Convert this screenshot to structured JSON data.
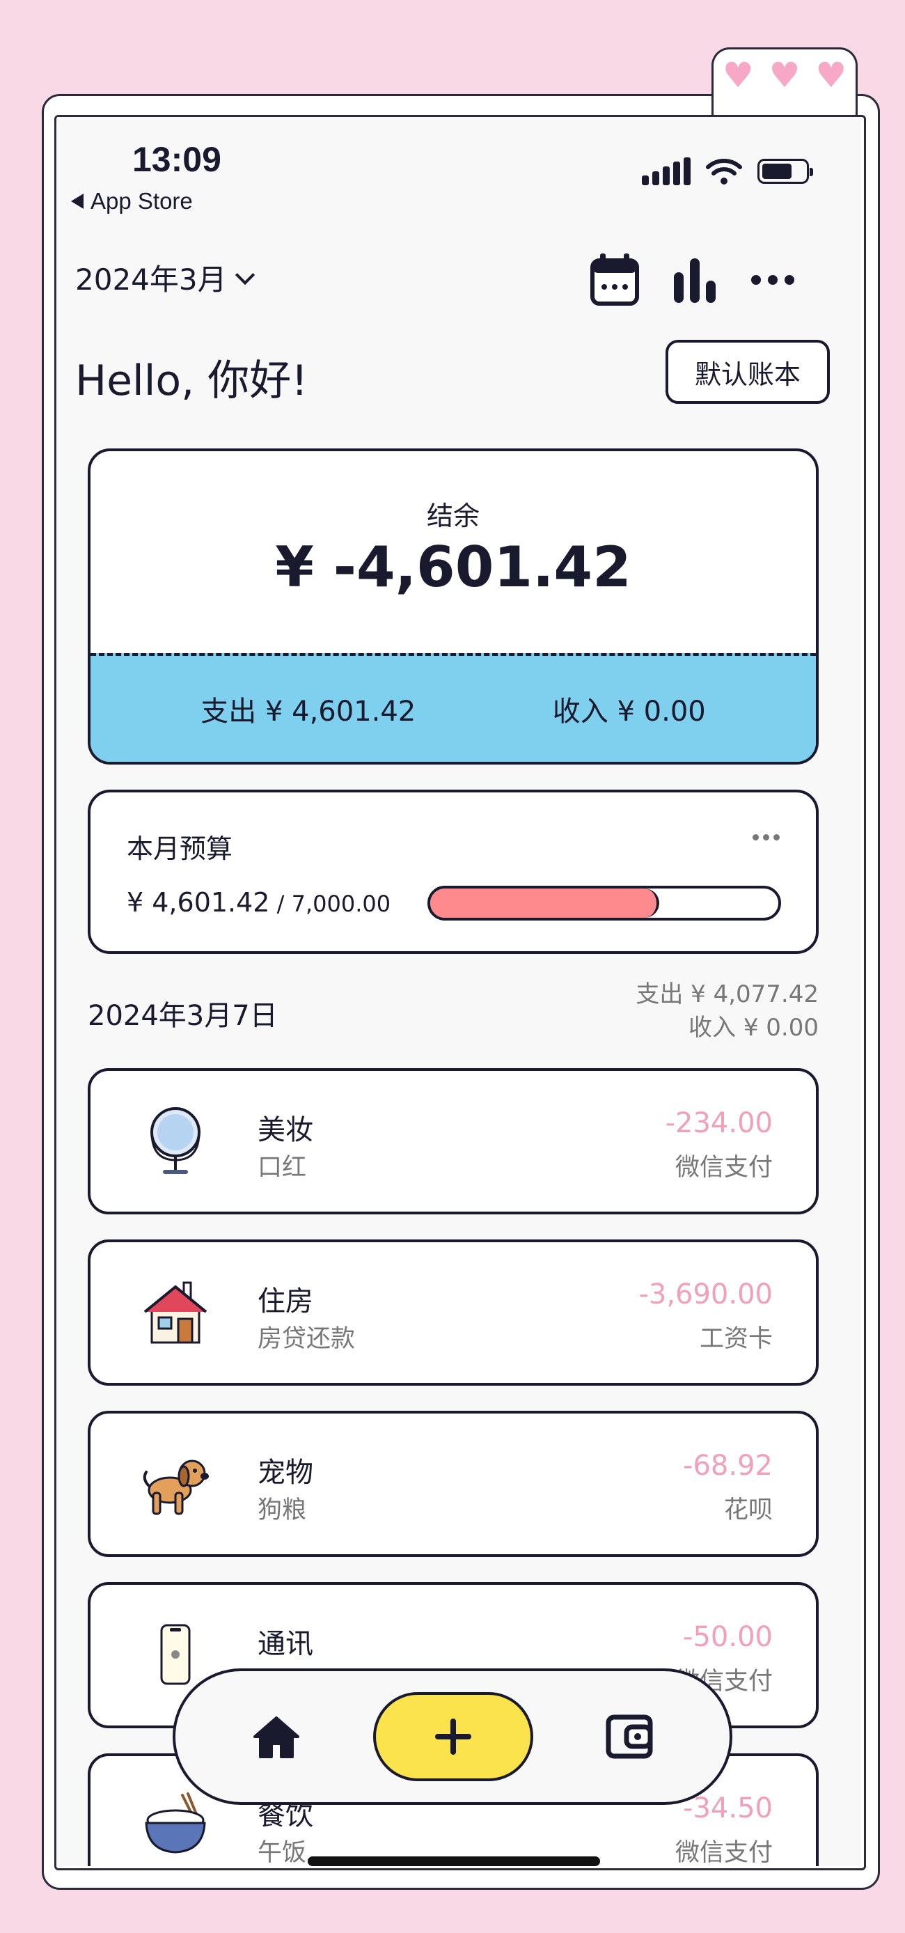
{
  "status_bar": {
    "time": "13:09",
    "back_label": "App Store"
  },
  "header": {
    "month": "2024年3月",
    "greeting": "Hello, 你好!",
    "account_button": "默认账本"
  },
  "balance": {
    "label": "结余",
    "value": "¥ -4,601.42",
    "expense": "支出 ¥ 4,601.42",
    "income": "收入 ¥ 0.00"
  },
  "budget": {
    "title": "本月预算",
    "spent": "¥ 4,601.42",
    "total": " / 7,000.00",
    "progress_fraction": 0.657
  },
  "day": {
    "date": "2024年3月7日",
    "expense": "支出 ¥ 4,077.42",
    "income": "收入 ¥ 0.00"
  },
  "transactions": [
    {
      "icon": "mirror-icon",
      "category": "美妆",
      "note": "口红",
      "amount": "-234.00",
      "payment": "微信支付"
    },
    {
      "icon": "house-icon",
      "category": "住房",
      "note": "房贷还款",
      "amount": "-3,690.00",
      "payment": "工资卡"
    },
    {
      "icon": "dog-icon",
      "category": "宠物",
      "note": "狗粮",
      "amount": "-68.92",
      "payment": "花呗"
    },
    {
      "icon": "phone-icon",
      "category": "通讯",
      "note": "",
      "amount": "-50.00",
      "payment": "微信支付"
    },
    {
      "icon": "rice-bowl-icon",
      "category": "餐饮",
      "note": "午饭",
      "amount": "-34.50",
      "payment": "微信支付"
    }
  ],
  "colors": {
    "background": "#f9d9e5",
    "balance_band": "#7fd0ef",
    "budget_fill": "#ff8a8e",
    "expense_amount": "#f2a0b8",
    "add_button": "#fae34c"
  }
}
